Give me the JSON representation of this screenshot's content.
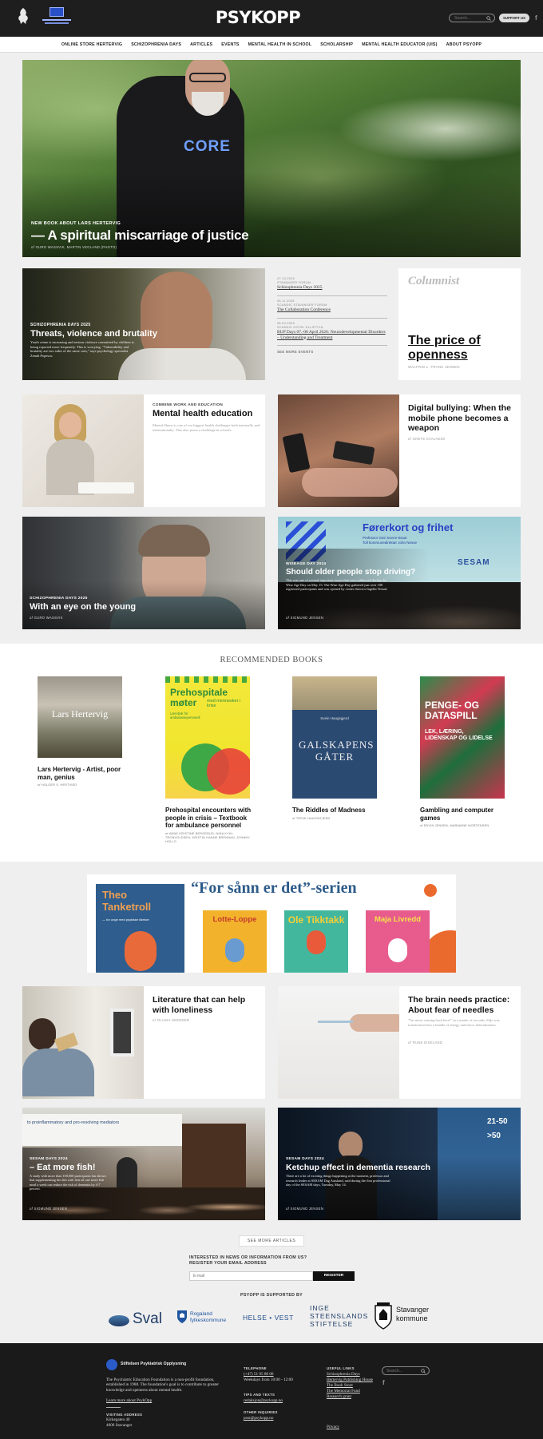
{
  "header": {
    "logo": "PSYKOPP",
    "search_placeholder": "Search...",
    "support_label": "SUPPORT US",
    "colors": {
      "bg": "#1e1e1e"
    }
  },
  "nav": {
    "items": [
      "ONLINE STORE HERTERVIG",
      "SCHIZOPHRENIA DAYS",
      "ARTICLES",
      "EVENTS",
      "MENTAL HEALTH IN SCHOOL",
      "SCHOLARSHIP",
      "MENTAL HEALTH EDUCATOR (UIS)",
      "ABOUT PSYOPP"
    ]
  },
  "hero": {
    "kicker": "NEW BOOK ABOUT LARS HERTERVIG",
    "title": "— A spiritual miscarriage of justice",
    "byline": "GURO WASSVIK, MARTIN VEGLAND (PHOTO)",
    "shirt_text": "CORE"
  },
  "feature": {
    "kicker": "SCHIZOPHRENIA DAYS 2025",
    "title": "Threats, violence and brutality",
    "excerpt": "Youth crime is increasing and serious violence committed by children is being reported more frequently. This is worrying. \"Vulnerability and brutality are two sides of the same coin,\" says psychology specialist Zenab Popescu."
  },
  "events": {
    "items": [
      {
        "date": "27.10.2025",
        "cat": "STAVANGER FORUM",
        "title": "Schizophrenia Days 2025"
      },
      {
        "date": "05.11.2025",
        "cat": "SCANDIC STAVANGER FORUM",
        "title": "The Collaboration Conference"
      },
      {
        "date": "08.04.2026",
        "cat": "SCANDIC HOTEL ELLIPTICA",
        "title": "BUP Days 07.-08 April 2026: Neurodevelopmental Disorders – Understanding and Treatment"
      }
    ],
    "see_more": "SEE MORE EVENTS"
  },
  "columnist": {
    "label": "Columnist",
    "title": "The price of openness",
    "author": "WALFRID L. FRANK JENSEN"
  },
  "articles": {
    "mental_health": {
      "kicker": "COMBINE WORK AND EDUCATION",
      "title": "Mental health education",
      "excerpt": "Mental illness is one of our biggest health challenges both nationally and internationally. This also poses a challenge in schools."
    },
    "bullying": {
      "title": "Digital bullying: When the mobile phone becomes a weapon",
      "byline": "GRETE KVALHEIM"
    },
    "young": {
      "kicker": "SCHIZOPHRENIA DAYS 2025",
      "title": "With an eye on the young",
      "byline": "GURO WASSVIK"
    },
    "driving": {
      "kicker": "WISEAGE DAY 2024",
      "title": "Should older people stop driving?",
      "excerpt": "This was one of several important issues that were addressed during the Wise Age Day on May 15. The Wise Age Day gathered just over 100 registered participants and was opened by center director Ingelin Testad.",
      "byline": "SIGMUND JENSEN",
      "slide_title": "Førerkort og frihet",
      "slide_sub1": "Professor Geir Sverre Braut",
      "slide_sub2": "Toll kommunedirektør John Nesse",
      "slide_logo": "SESAM"
    },
    "loneliness": {
      "title": "Literature that can help with loneliness",
      "byline": "OLIANA SKENDER"
    },
    "needles": {
      "title": "The brain needs practice: About fear of needles",
      "excerpt": "\"I'm never coming back here!\" in a matter of seconds, Silje was transformed into a bundle of energy and fierce determination.",
      "byline": "RUNE EIKELAND"
    },
    "fish": {
      "kicker": "SESAM DAYS 2024",
      "title": "– Eat more fish!",
      "excerpt": "A study with more than 100,000 participants has shown that supplementing the diet with fish oil one more fish meal a week can reduce the risk of dementia by 4-7 percent.",
      "byline": "SIGMUND JENSEN",
      "slide_text": "to proinflammatory and pro-resolving mediators"
    },
    "ketchup": {
      "kicker": "SESAM DAYS 2024",
      "title": "Ketchup effect in dementia research",
      "excerpt": "There are a lot of exciting things happening at the moment, professor and research leader at SESAM Dag Aarsland, said during the first professional day of the SESAM days, Tuesday, May 14.",
      "byline": "SIGMUND JENSEN",
      "slide_text1": "21-50",
      "slide_text2": ">50"
    }
  },
  "books": {
    "heading": "RECOMMENDED BOOKS",
    "items": [
      {
        "title": "Lars Hertervig - Artist, poor man, genius",
        "author": "HOLGER S. HERTVIED",
        "cover_title": "Lars Hertervig"
      },
      {
        "title": "Prehospital encounters with people in crisis – Textbook for ambulance personnel",
        "author": "ANNE KRISTINE BERGERUD, NINA KYHL TRONVOLDSEN, KRISTIN HANNE BRENNAN, JOHNNY HOLLO",
        "cover_title": "Prehospitale møter",
        "cover_sub": "med mennesker i krise",
        "cover_desc": "Lærebok for ambulansepersonell"
      },
      {
        "title": "The Riddles of Madness",
        "author": "TERJE HAUGSGJERD",
        "cover_author": "Svein Haugsgjerd",
        "cover_title": "GALSKAPENS GÅTER"
      },
      {
        "title": "Gambling and computer games",
        "author": "EDVIN JENSEN, MARIANNE MORTENSEN",
        "cover_title": "PENGE- OG DATASPILL",
        "cover_sub": "LEK, LÆRING, LIDENSKAP OG LIDELSE"
      }
    ]
  },
  "banner": {
    "title": "“For sånn er det”-serien",
    "books": [
      "Theo Tanketroll",
      "Lotte-Loppe",
      "Ole Tikktakk",
      "Maja Livredd"
    ],
    "tagline": "— for unge med psykiske lidelser"
  },
  "more": {
    "label": "SEE MORE ARTICLES"
  },
  "newsletter": {
    "line1": "INTERESTED IN NEWS OR INFORMATION FROM US?",
    "line2": "REGISTER YOUR EMAIL ADDRESS",
    "placeholder": "E-mail",
    "button": "REGISTER"
  },
  "sponsors": {
    "heading": "PSYOPP IS SUPPORTED BY",
    "items": [
      "Sval",
      "Rogaland fylkeskommune",
      "HELSE • VEST",
      "INGE STEENSLANDS STIFTELSE",
      "Stavanger kommune"
    ]
  },
  "footer": {
    "org": "Stiftelsen Psykiatrisk Opplysning",
    "about": "The Psychiatric Education Foundation is a non-profit foundation, established in 1988. The foundation's goal is to contribute to greater knowledge and openness about mental health.",
    "learn_more": "Learn more about PsykOpp",
    "visit_h": "VISITING ADDRESS",
    "address1": "Kirkegaten 40",
    "address2": "4006 Stavanger",
    "phone_h": "TELEPHONE",
    "phone": "(+47) 51 95 88 00",
    "hours": "Weekdays from 10:00 - 12:00",
    "tips_h": "TIPS AND TEXTS",
    "tips_email": "redaksjon@psykopp.no",
    "other_h": "OTHER INQUIRIES",
    "other_email": "post@psykopp.no",
    "links_h": "USEFUL LINKS",
    "links": [
      "Schizophrenia Days",
      "Hertervig Publishing House",
      "The Book Store",
      "The Memorial Fund",
      "Research grant"
    ],
    "privacy": "Privacy",
    "search_placeholder": "Search..."
  }
}
